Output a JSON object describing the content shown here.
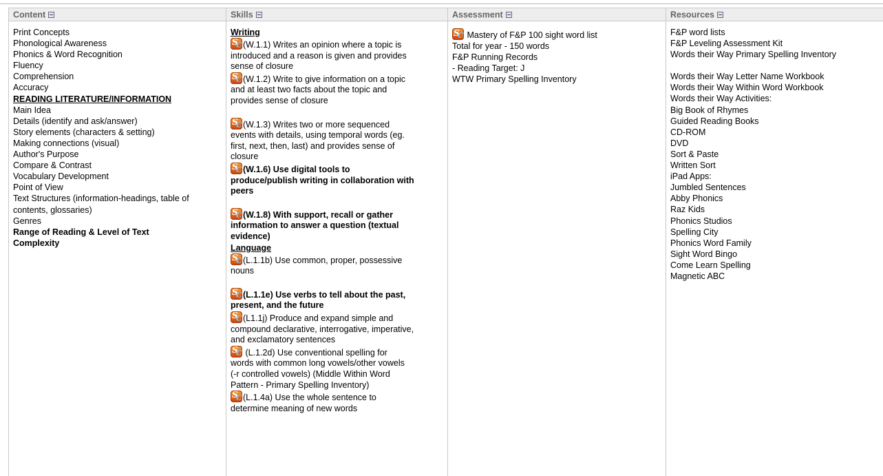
{
  "headers": {
    "content": "Content",
    "skills": "Skills",
    "assessment": "Assessment",
    "resources": "Resources"
  },
  "content_items": [
    {
      "text": "Print Concepts",
      "style": ""
    },
    {
      "text": "Phonological Awareness",
      "style": ""
    },
    {
      "text": "Phonics & Word Recognition",
      "style": ""
    },
    {
      "text": "Fluency",
      "style": ""
    },
    {
      "text": "Comprehension",
      "style": ""
    },
    {
      "text": "Accuracy",
      "style": ""
    },
    {
      "text": "READING LITERATURE/INFORMATION",
      "style": "bold uline"
    },
    {
      "text": "Main Idea",
      "style": ""
    },
    {
      "text": "Details (identify and ask/answer)",
      "style": ""
    },
    {
      "text": "Story elements (characters & setting)",
      "style": ""
    },
    {
      "text": "Making connections (visual)",
      "style": ""
    },
    {
      "text": "Author's Purpose",
      "style": ""
    },
    {
      "text": "Compare & Contrast",
      "style": ""
    },
    {
      "text": "Vocabulary Development",
      "style": ""
    },
    {
      "text": "Point of View",
      "style": ""
    },
    {
      "text": "Text Structures (information-headings, table of",
      "style": ""
    },
    {
      "text": "contents, glossaries)",
      "style": ""
    },
    {
      "text": "Genres",
      "style": ""
    },
    {
      "text": "Range of Reading & Level of Text",
      "style": "bold"
    },
    {
      "text": "Complexity",
      "style": "bold"
    }
  ],
  "skills": {
    "writing_heading": "Writing",
    "language_heading": "Language",
    "writing": [
      {
        "lines": [
          "(W.1.1) Writes an opinion where a topic is",
          "introduced and a reason is given and provides",
          "sense of closure"
        ],
        "bold": false,
        "gap_after": false
      },
      {
        "lines": [
          "(W.1.2) Write to give information on a topic",
          "and at least two facts about the topic  and",
          "provides sense of closure"
        ],
        "bold": false,
        "gap_after": true
      },
      {
        "lines": [
          "(W.1.3) Writes two or more sequenced",
          "events with details, using temporal words (eg.",
          "first, next, then, last) and provides sense of",
          "closure"
        ],
        "bold": false,
        "gap_after": false
      },
      {
        "lines": [
          "(W.1.6) Use digital tools to",
          "produce/publish writing in collaboration with",
          "peers"
        ],
        "bold": true,
        "gap_after": true
      },
      {
        "lines": [
          "(W.1.8) With support, recall or gather",
          "information to answer a question (textual",
          "evidence)"
        ],
        "bold": true,
        "gap_after": false
      }
    ],
    "language": [
      {
        "lines": [
          "(L.1.1b) Use common, proper, possessive",
          "nouns"
        ],
        "bold": false,
        "gap_after": true
      },
      {
        "lines": [
          "(L.1.1e) Use verbs to tell about the past,",
          "present, and the future"
        ],
        "bold": true,
        "gap_after": false
      },
      {
        "lines": [
          "(L1.1j) Produce and expand simple and",
          "compound declarative, interrogative, imperative,",
          "and exclamatory sentences"
        ],
        "bold": false,
        "gap_after": false
      },
      {
        "lines": [
          " (L.1.2d) Use conventional spelling for",
          "words with common long vowels/other vowels",
          "(-r controlled vowels)  (Middle Within Word",
          "Pattern - Primary Spelling Inventory)"
        ],
        "bold": false,
        "gap_after": false
      },
      {
        "lines": [
          "(L.1.4a) Use the whole sentence to",
          "determine meaning of new words"
        ],
        "bold": false,
        "gap_after": false
      }
    ]
  },
  "assessment": {
    "first_item": " Mastery of F&P 100 sight word list",
    "items": [
      "Total for year - 150 words",
      "F&P Running Records",
      " - Reading Target: J",
      "WTW Primary Spelling Inventory"
    ]
  },
  "resources": {
    "group1": [
      "F&P word lists",
      "F&P Leveling Assessment Kit",
      "Words their Way Primary Spelling Inventory"
    ],
    "group2": [
      "Words their Way Letter Name Workbook",
      "Words their Way Within Word Workbook",
      "Words their Way Activities:",
      "Big Book of Rhymes",
      "Guided Reading Books",
      "CD-ROM",
      "DVD",
      "Sort & Paste",
      "Written Sort",
      "iPad Apps:",
      "Jumbled Sentences",
      "Abby Phonics",
      "Raz Kids",
      "Phonics Studios",
      "Spelling City",
      "Phonics Word Family",
      "Sight Word Bingo",
      "Come Learn Spelling",
      "Magnetic ABC"
    ]
  }
}
